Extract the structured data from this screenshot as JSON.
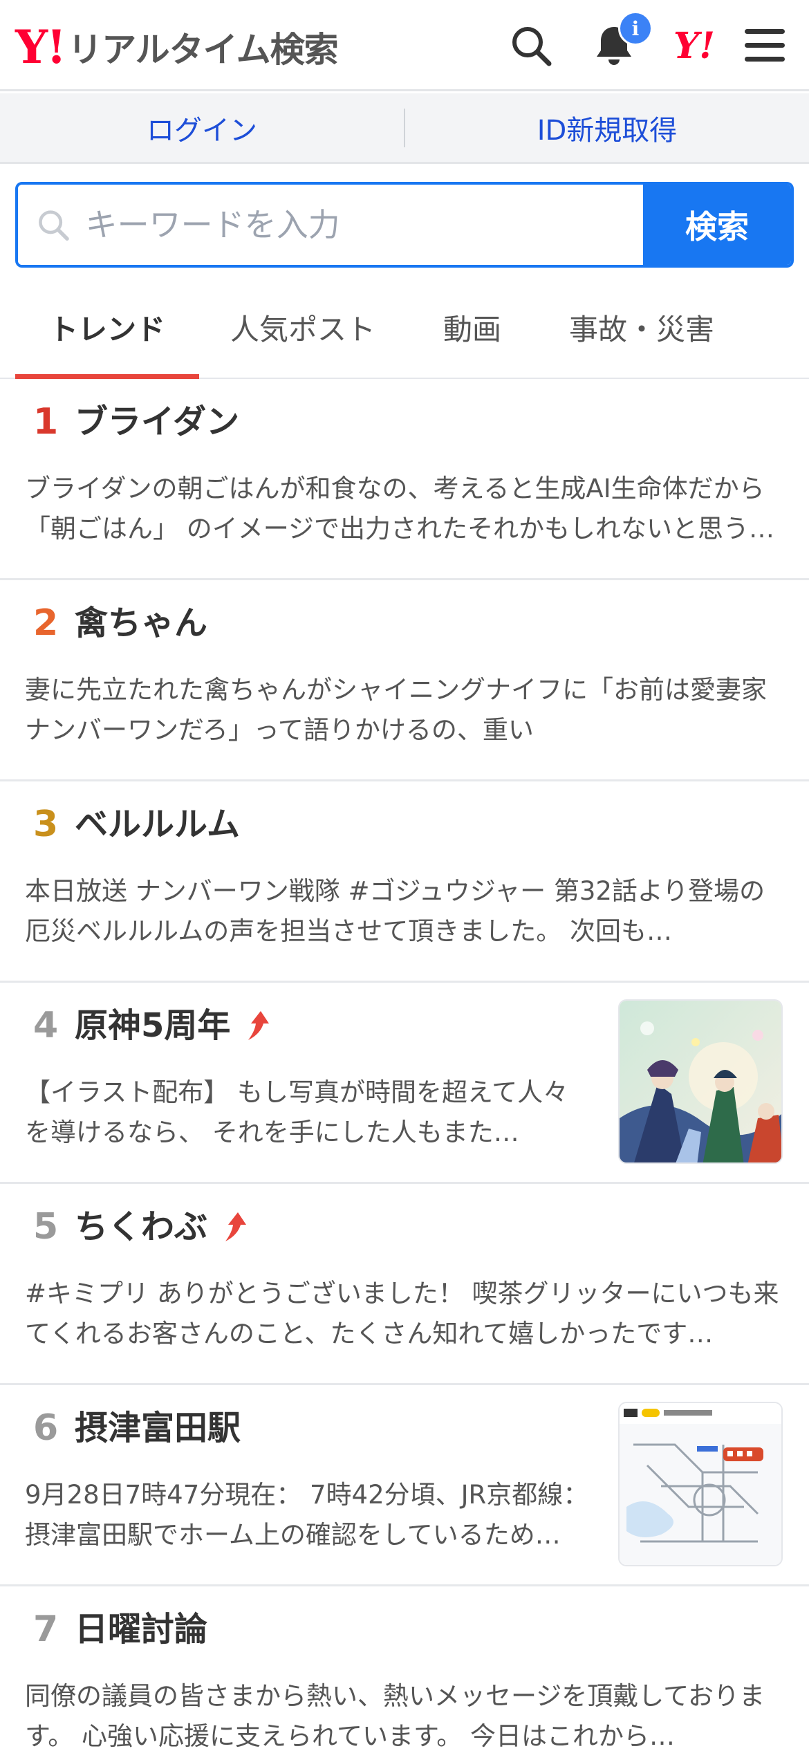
{
  "header": {
    "logo_y": "Y!",
    "logo_text": "リアルタイム検索",
    "notification_badge": "i",
    "yj_mark": "Y!"
  },
  "auth": {
    "login": "ログイン",
    "signup": "ID新規取得"
  },
  "search": {
    "placeholder": "キーワードを入力",
    "button": "検索"
  },
  "tabs": [
    {
      "label": "トレンド",
      "active": true
    },
    {
      "label": "人気ポスト",
      "active": false
    },
    {
      "label": "動画",
      "active": false
    },
    {
      "label": "事故・災害",
      "active": false
    }
  ],
  "colors": {
    "brand_red": "#ff0033",
    "accent_blue": "#1877f2",
    "rank1": "#d9382c",
    "rank2": "#e8652d",
    "rank3": "#c9901c",
    "rank_other": "#9a9a9a",
    "tab_underline": "#e8453c"
  },
  "trends": [
    {
      "rank": "1",
      "title": "ブライダン",
      "rising": false,
      "has_thumb": false,
      "desc": "ブライダンの朝ごはんが和食なの、考えると生成AI生命体だから 「朝ごはん」 のイメージで出力されたそれかもしれないと思うと…"
    },
    {
      "rank": "2",
      "title": "禽ちゃん",
      "rising": false,
      "has_thumb": false,
      "desc": "妻に先立たれた禽ちゃんがシャイニングナイフに「お前は愛妻家ナンバーワンだろ」って語りかけるの、重い"
    },
    {
      "rank": "3",
      "title": "ベルルルム",
      "rising": false,
      "has_thumb": false,
      "desc": "本日放送 ナンバーワン戦隊 #ゴジュウジャー 第32話より登場の厄災ベルルルムの声を担当させて頂きました。 次回も…"
    },
    {
      "rank": "4",
      "title": "原神5周年",
      "rising": true,
      "has_thumb": true,
      "thumb": "game-art-thumbnail",
      "desc": "【イラスト配布】 もし写真が時間を超えて人々を導けるなら、 それを手にした人もまた…"
    },
    {
      "rank": "5",
      "title": "ちくわぶ",
      "rising": true,
      "has_thumb": false,
      "desc": "#キミプリ ありがとうございました！ 喫茶グリッターにいつも来てくれるお客さんのこと、たくさん知れて嬉しかったです…"
    },
    {
      "rank": "6",
      "title": "摂津富田駅",
      "rising": false,
      "has_thumb": true,
      "thumb": "railway-map-thumbnail",
      "desc": "9月28日7時47分現在： 7時42分頃、JR京都線：摂津富田駅でホーム上の確認をしているため…"
    },
    {
      "rank": "7",
      "title": "日曜討論",
      "rising": false,
      "has_thumb": false,
      "desc": "同僚の議員の皆さまから熱い、熱いメッセージを頂戴しております。 心強い応援に支えられています。 今日はこれから…"
    }
  ]
}
